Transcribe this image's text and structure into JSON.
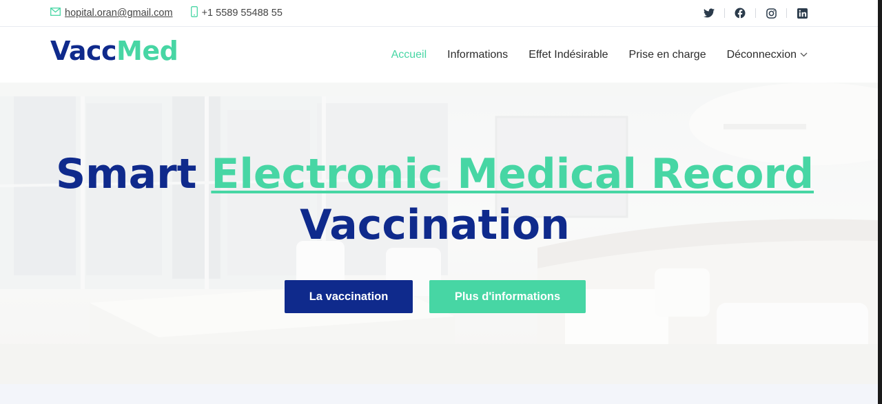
{
  "topbar": {
    "email": "hopital.oran@gmail.com",
    "phone": "+1 5589 55488 55",
    "email_icon": "envelope-icon",
    "phone_icon": "phone-icon",
    "social": [
      "twitter-icon",
      "facebook-icon",
      "instagram-icon",
      "linkedin-icon"
    ]
  },
  "header": {
    "logo_part1": "Vacc",
    "logo_part2": "Med",
    "nav": {
      "home": "Accueil",
      "info": "Informations",
      "effect": "Effet Indésirable",
      "care": "Prise en charge",
      "logout": "Déconnecxion"
    }
  },
  "hero": {
    "title_part1": "Smart",
    "title_highlight": "Electronic Medical Record",
    "title_line2": "Vaccination",
    "button_primary": "La vaccination",
    "button_secondary": "Plus d'informations"
  },
  "colors": {
    "navy": "#0f2a8c",
    "accent": "#47d6a4"
  }
}
